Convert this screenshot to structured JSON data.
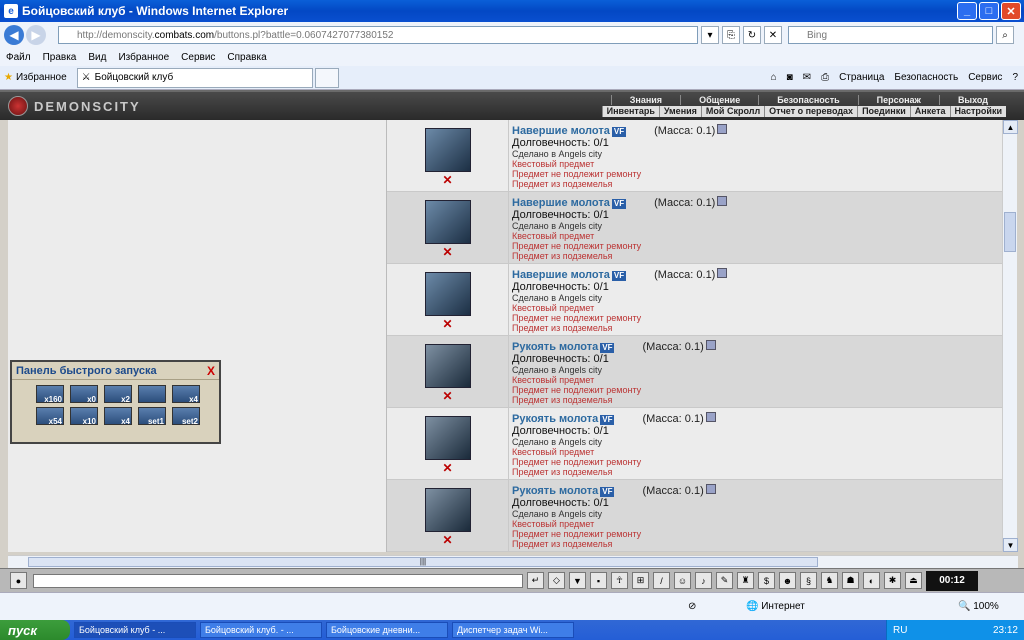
{
  "window": {
    "title": "Бойцовский клуб - Windows Internet Explorer"
  },
  "address": {
    "url_prefix": "http://demonscity.",
    "url_host": "combats.com",
    "url_rest": "/buttons.pl?battle=0.0607427077380152",
    "search_placeholder": "Bing"
  },
  "menu": [
    "Файл",
    "Правка",
    "Вид",
    "Избранное",
    "Сервис",
    "Справка"
  ],
  "favorites": {
    "label": "Избранное",
    "tab_title": "Бойцовский клуб"
  },
  "ie_tools": [
    "Страница",
    "Безопасность",
    "Сервис"
  ],
  "game": {
    "logo": "DEMONSCITY",
    "top_nav": [
      "Знания",
      "Общение",
      "Безопасность",
      "Персонаж",
      "Выход"
    ],
    "sub_nav": [
      "Инвентарь",
      "Умения",
      "Мой Скролл",
      "Отчет о переводах",
      "Поединки",
      "Анкета",
      "Настройки"
    ]
  },
  "quick_panel": {
    "title": "Панель быстрого запуска",
    "close": "X",
    "items": [
      "x160",
      "x0",
      "x2",
      "",
      "x4",
      "x54",
      "x10",
      "x4",
      "set1",
      "set2"
    ]
  },
  "items": [
    {
      "name": "Навершие молота",
      "vf": "VF",
      "mass": "(Масса: 0.1)",
      "dur": "Долговечность: 0/1",
      "made": "Сделано в Angels city",
      "l1": "Квестовый предмет",
      "l2": "Предмет не подлежит ремонту",
      "l3": "Предмет из подземелья",
      "kind": "head"
    },
    {
      "name": "Навершие молота",
      "vf": "VF",
      "mass": "(Масса: 0.1)",
      "dur": "Долговечность: 0/1",
      "made": "Сделано в Angels city",
      "l1": "Квестовый предмет",
      "l2": "Предмет не подлежит ремонту",
      "l3": "Предмет из подземелья",
      "kind": "head"
    },
    {
      "name": "Навершие молота",
      "vf": "VF",
      "mass": "(Масса: 0.1)",
      "dur": "Долговечность: 0/1",
      "made": "Сделано в Angels city",
      "l1": "Квестовый предмет",
      "l2": "Предмет не подлежит ремонту",
      "l3": "Предмет из подземелья",
      "kind": "head"
    },
    {
      "name": "Рукоять молота",
      "vf": "VF",
      "mass": "(Масса: 0.1)",
      "dur": "Долговечность: 0/1",
      "made": "Сделано в Angels city",
      "l1": "Квестовый предмет",
      "l2": "Предмет не подлежит ремонту",
      "l3": "Предмет из подземелья",
      "kind": "rod"
    },
    {
      "name": "Рукоять молота",
      "vf": "VF",
      "mass": "(Масса: 0.1)",
      "dur": "Долговечность: 0/1",
      "made": "Сделано в Angels city",
      "l1": "Квестовый предмет",
      "l2": "Предмет не подлежит ремонту",
      "l3": "Предмет из подземелья",
      "kind": "rod"
    },
    {
      "name": "Рукоять молота",
      "vf": "VF",
      "mass": "(Масса: 0.1)",
      "dur": "Долговечность: 0/1",
      "made": "Сделано в Angels city",
      "l1": "Квестовый предмет",
      "l2": "Предмет не подлежит ремонту",
      "l3": "Предмет из подземелья",
      "kind": "rod"
    }
  ],
  "clock": "00:12",
  "status": {
    "zone": "Интернет",
    "zoom": "100%"
  },
  "taskbar": {
    "start": "пуск",
    "tasks": [
      "Бойцовский клуб - ...",
      "Бойцовский клуб. - ...",
      "Бойцовские дневни...",
      "Диспетчер задач Wi..."
    ],
    "lang": "RU",
    "time": "23:12"
  }
}
